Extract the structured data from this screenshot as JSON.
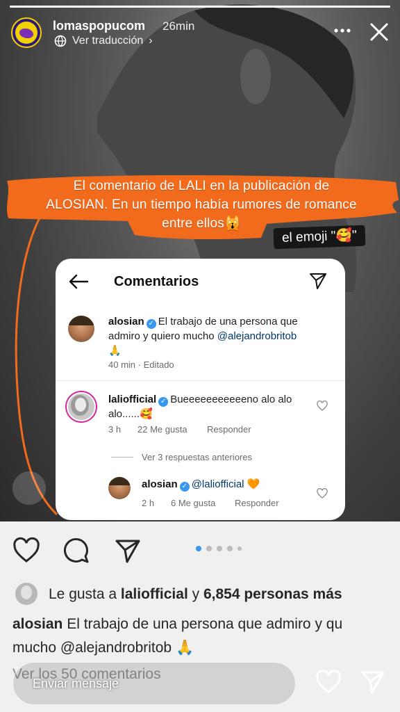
{
  "story": {
    "username": "lomaspopucom",
    "time": "26min",
    "translate_label": "Ver traducción",
    "progress_fraction": 1.0,
    "reply_placeholder": "Enviar mensaje"
  },
  "overlay": {
    "caption_lines": [
      "El comentario de LALI en la publicación de",
      "ALOSIAN. En un tiempo había rumores de romance",
      "entre ellos🙀"
    ],
    "emoji_tag": "el emoji \"🥰\""
  },
  "comments_card": {
    "title": "Comentarios",
    "comments": [
      {
        "user": "alosian",
        "text": "El trabajo de una persona que",
        "text2_prefix": "admiro y quiero mucho ",
        "mention": "@alejandrobritob",
        "emoji": "🙏",
        "meta": "40 min · Editado"
      },
      {
        "user": "laliofficial",
        "text": "Bueeeeeeeeeeeno alo alo",
        "text2": "alo......🥰",
        "time": "3 h",
        "likes": "22 Me gusta",
        "reply": "Responder"
      }
    ],
    "replies_link": "Ver 3 respuestas anteriores",
    "reply": {
      "user": "alosian",
      "mention": "@laliofficial",
      "emoji": "🧡",
      "time": "2 h",
      "likes": "6 Me gusta",
      "reply_label": "Responder"
    }
  },
  "post": {
    "carousel_count": 5,
    "carousel_active": 1,
    "likes_prefix": "Le gusta a ",
    "likes_user": "laliofficial",
    "likes_middle": " y ",
    "likes_count": "6,854 personas más",
    "caption_user": "alosian",
    "caption_text1": " El trabajo de una persona que admiro y qu",
    "caption_text2": "mucho @alejandrobritob 🙏",
    "view_all": "Ver los 50 comentarios"
  },
  "colors": {
    "orange": "#f26b1d",
    "verified": "#3897f0",
    "mention": "#00376b"
  }
}
